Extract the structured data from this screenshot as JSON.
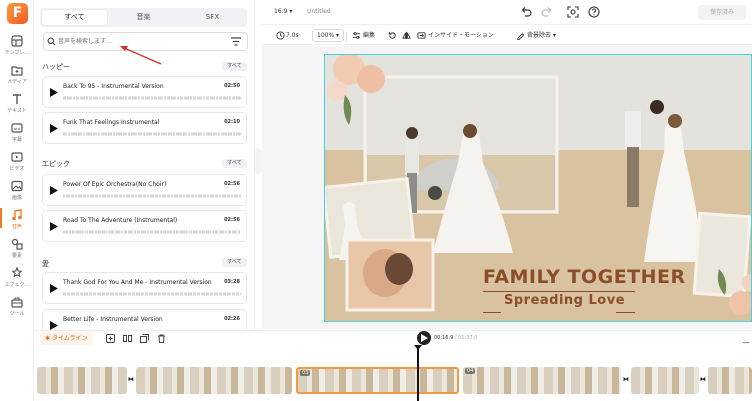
{
  "sidebar": {
    "logo": "F",
    "items": [
      {
        "label": "テンプレ…",
        "icon": "template-icon"
      },
      {
        "label": "メディア",
        "icon": "media-icon"
      },
      {
        "label": "テキスト",
        "icon": "text-icon"
      },
      {
        "label": "字幕",
        "icon": "subtitle-icon"
      },
      {
        "label": "ビデオ",
        "icon": "video-icon"
      },
      {
        "label": "画像",
        "icon": "image-icon"
      },
      {
        "label": "音声",
        "icon": "audio-icon",
        "active": true
      },
      {
        "label": "要素",
        "icon": "elements-icon"
      },
      {
        "label": "エフェク…",
        "icon": "effects-icon"
      },
      {
        "label": "ツール",
        "icon": "tools-icon"
      }
    ]
  },
  "library": {
    "tabs": [
      "すべて",
      "音楽",
      "SFX"
    ],
    "search_placeholder": "音声を検索します...",
    "all_label": "すべて",
    "sections": [
      {
        "title": "ハッピー",
        "tracks": [
          {
            "name": "Back To 95 - Instrumental Version",
            "duration": "02:50"
          },
          {
            "name": "Funk That Feelings Instrumental",
            "duration": "02:10"
          }
        ]
      },
      {
        "title": "エピック",
        "tracks": [
          {
            "name": "Power Of Epic Orchestra(No Choir)",
            "duration": "02:56"
          },
          {
            "name": "Road To The Adventure (Instrumental)",
            "duration": "02:56"
          }
        ]
      },
      {
        "title": "愛",
        "tracks": [
          {
            "name": "Thank God For You And Me - Instrumental Version",
            "duration": "03:28"
          },
          {
            "name": "Better Life - Instrumental Version",
            "duration": "02:26"
          }
        ]
      }
    ]
  },
  "topbar": {
    "ratio": "16:9 ▾",
    "title": "Untitled",
    "save": "保存済み"
  },
  "toolbar": {
    "duration": "7.0s",
    "zoom": "100% ▾",
    "edit": "編集",
    "inside_motion": "インサイド・モーション",
    "bg_remove": "背景除去 ▾"
  },
  "canvas": {
    "title": "FAMILY TOGETHER",
    "subtitle": "Spreading Love"
  },
  "timeline": {
    "label": "タイムライン",
    "current": "00:16:9",
    "total": "/ 01:37.0",
    "clips": [
      "",
      "03",
      "04"
    ],
    "menu": "—"
  },
  "colors": {
    "accent": "#f07a26",
    "selection": "#4fd0d6",
    "title_brown": "#8b4d2a"
  }
}
